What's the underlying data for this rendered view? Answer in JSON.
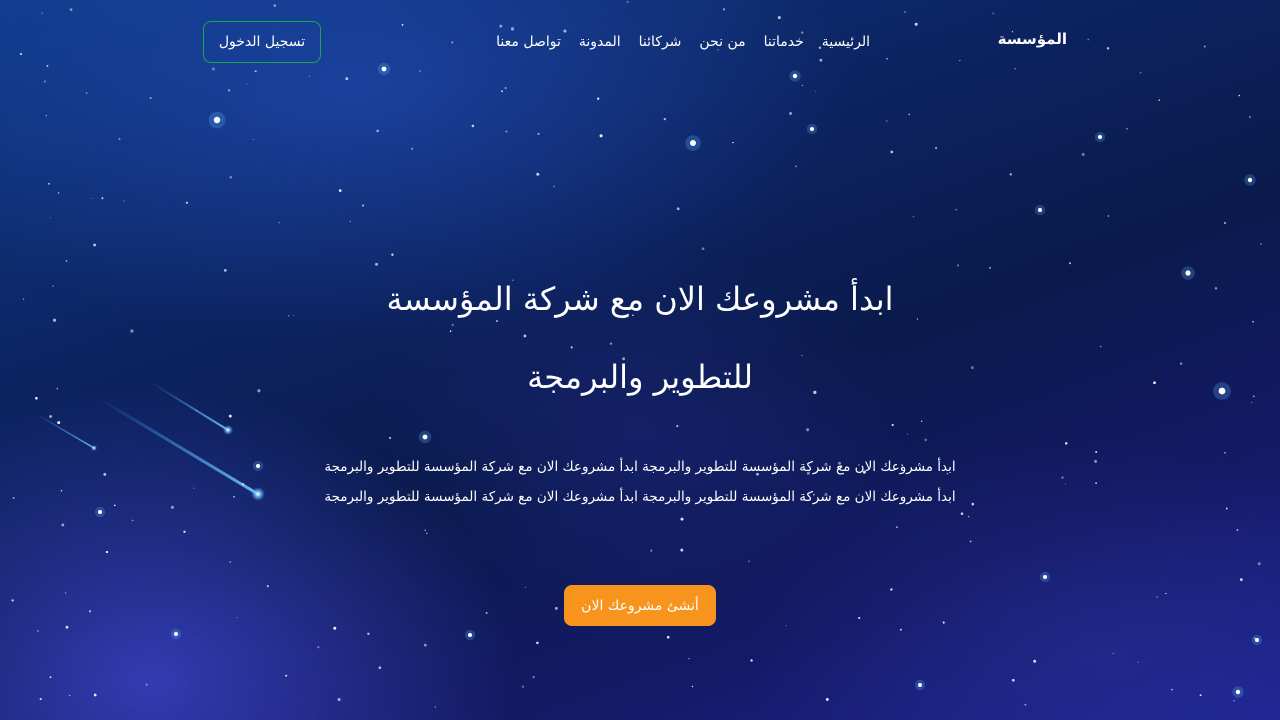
{
  "brand": {
    "name": "المؤسسة"
  },
  "nav": {
    "items": [
      {
        "label": "الرئيسية"
      },
      {
        "label": "خدماتنا"
      },
      {
        "label": "من نحن"
      },
      {
        "label": "شركائنا"
      },
      {
        "label": "المدونة"
      },
      {
        "label": "تواصل معنا"
      }
    ],
    "login_label": "تسجيل الدخول"
  },
  "hero": {
    "title_line1": "ابدأ مشروعك الان مع شركة المؤسسة",
    "title_line2": "للتطوير والبرمجة",
    "description": "ابدأ مشروعك الان مع شركة المؤسسة للتطوير والبرمجة ابدأ مشروعك الان مع شركة المؤسسة للتطوير والبرمجة ابدأ مشروعك الان مع شركة المؤسسة للتطوير والبرمجة ابدأ مشروعك الان مع شركة المؤسسة للتطوير والبرمجة",
    "cta_label": "أنشئ مشروعك الان"
  },
  "colors": {
    "login_border": "#1ea64c",
    "cta_background": "#f7941d",
    "background_top": "#0f3c8a",
    "background_bottom": "#1f2596"
  }
}
